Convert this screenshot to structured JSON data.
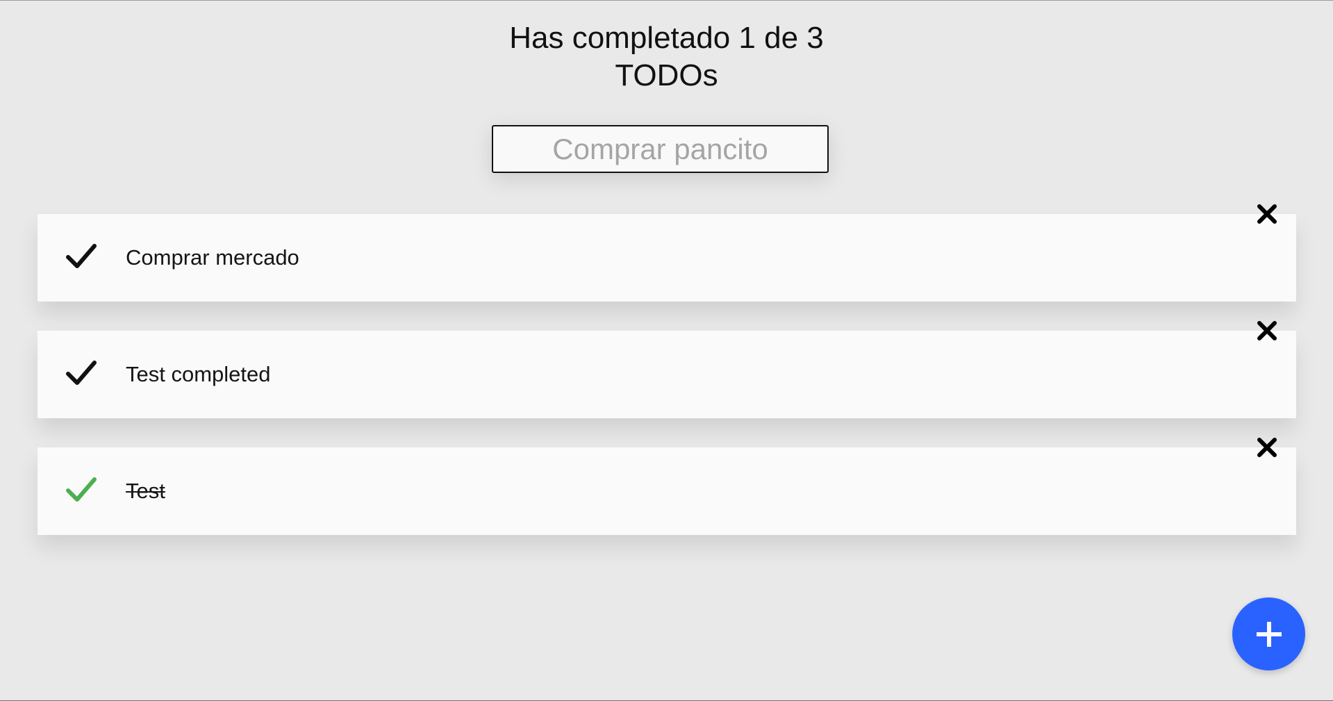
{
  "header": {
    "title_line1": "Has completado 1 de 3",
    "title_line2": "TODOs"
  },
  "search": {
    "placeholder": "Comprar pancito",
    "value": ""
  },
  "todos": [
    {
      "label": "Comprar mercado",
      "completed": false
    },
    {
      "label": "Test completed",
      "completed": false
    },
    {
      "label": "Test",
      "completed": true
    }
  ],
  "icons": {
    "check": "check-icon",
    "close": "close-icon",
    "add": "plus-icon"
  },
  "colors": {
    "background": "#e9e9e9",
    "card": "#fafafa",
    "check_default": "#111111",
    "check_completed": "#4caf50",
    "fab": "#2962ff",
    "fab_icon": "#ffffff"
  }
}
